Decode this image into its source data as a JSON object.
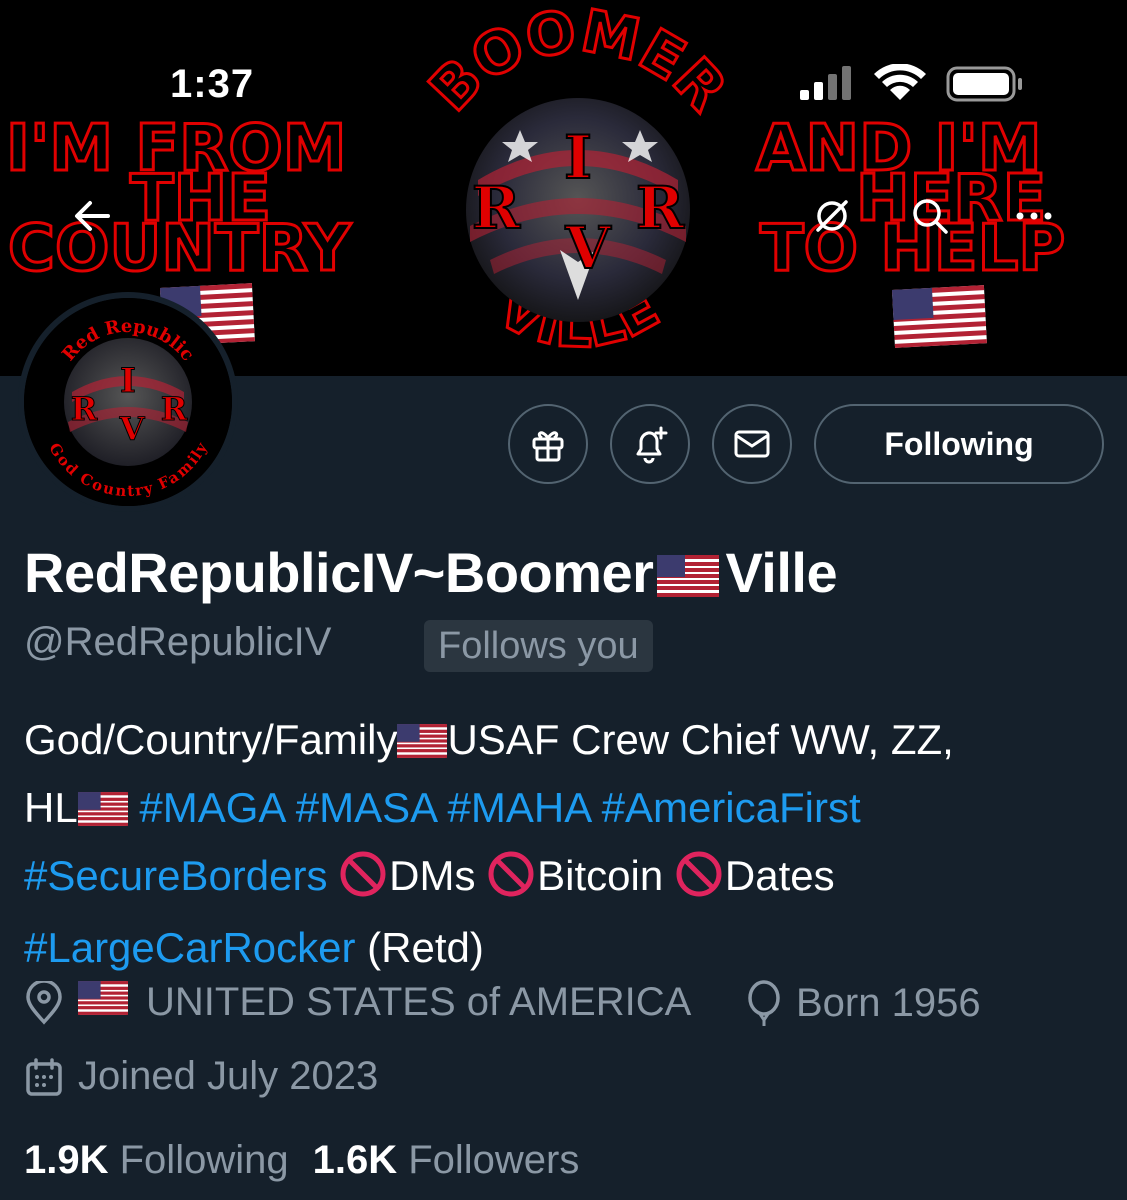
{
  "status_bar": {
    "time": "1:37"
  },
  "banner": {
    "left_text": [
      "I'M FROM",
      "THE",
      "COUNTRY"
    ],
    "right_text": [
      "AND I'M",
      "HERE",
      "TO HELP"
    ],
    "arc_top": "BOOMER",
    "arc_bottom": "VILLE",
    "emblem_letters": [
      "I",
      "R",
      "V",
      "R"
    ]
  },
  "avatar": {
    "arc_top": "Red Republic",
    "arc_bottom": "God Country Family",
    "emblem_letters": [
      "I",
      "R",
      "V",
      "R"
    ]
  },
  "actions": {
    "following_label": "Following"
  },
  "profile": {
    "display_name_part1": "RedRepublicIV~Boomer",
    "display_name_part2": "Ville",
    "handle": "@RedRepublicIV",
    "follows_you": "Follows you"
  },
  "bio": {
    "t1": "God/Country/Family",
    "t2": "USAF Crew Chief WW, ZZ,",
    "t3": "HL",
    "h1": "#MAGA",
    "h2": "#MASA",
    "h3": "#MAHA",
    "h4": "#AmericaFirst",
    "h5": "#SecureBorders",
    "t4": "DMs",
    "t5": "Bitcoin",
    "t6": "Dates",
    "h6": "#LargeCarRocker",
    "t7": "(Retd)"
  },
  "meta": {
    "location": "UNITED STATES of AMERICA",
    "born": "Born 1956",
    "joined": "Joined July 2023"
  },
  "stats": {
    "following_count": "1.9K",
    "following_label": "Following",
    "followers_count": "1.6K",
    "followers_label": "Followers"
  },
  "colors": {
    "background": "#15202b",
    "link": "#1d9bf0",
    "muted": "#8b98a5",
    "banner_red": "#e00000"
  },
  "icons": [
    "back-arrow-icon",
    "grok-icon",
    "search-icon",
    "more-icon",
    "gift-icon",
    "bell-plus-icon",
    "mail-icon",
    "location-pin-icon",
    "balloon-icon",
    "calendar-icon",
    "us-flag-icon",
    "no-entry-icon",
    "signal-icon",
    "wifi-icon",
    "battery-icon"
  ]
}
